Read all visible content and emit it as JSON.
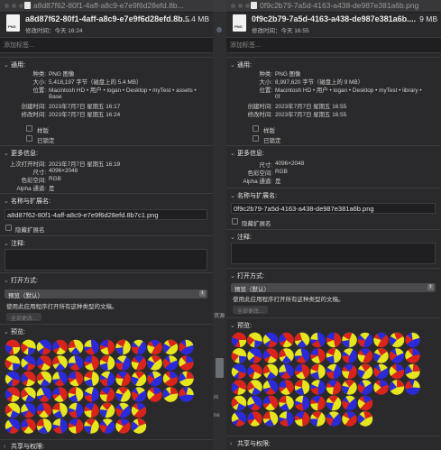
{
  "left": {
    "titlebar": "a8d87f62-80f1-4aff-a8c9-e7e9f6d28efd.8b...",
    "file_name": "a8d87f62-80f1-4aff-a8c9-e7e9f6d28efd.8b...",
    "file_size": "5.4 MB",
    "modified_short": "修改时间：今天 16:24",
    "tags_placeholder": "添加标签...",
    "general": {
      "header": "通用:",
      "kind_k": "种类:",
      "kind_v": "PNG 图像",
      "size_k": "大小:",
      "size_v": "5,418,197 字节（磁盘上的 5.4 MB）",
      "where_k": "位置:",
      "where_v": "Macintosh HD • 用户 • logan • Desktop • myTest • assets •",
      "where_v2": "Base",
      "created_k": "创建时间:",
      "created_v": "2023年7月7日 星期五 16:17",
      "modified_k": "修改时间:",
      "modified_v": "2023年7月7日 星期五 16:24",
      "stationery": "样版",
      "locked": "已锁定"
    },
    "more_info": {
      "header": "更多信息:",
      "last_opened_k": "上次打开时间:",
      "last_opened_v": "2023年7月7日 星期五 16:19",
      "dims_k": "尺寸:",
      "dims_v": "4096×2048",
      "color_k": "色彩空间:",
      "color_v": "RGB",
      "alpha_k": "Alpha 通道:",
      "alpha_v": "是"
    },
    "name_ext": {
      "header": "名称与扩展名:",
      "value": "a8d87f62-80f1-4aff-a8c9-e7e9f6d28efd.8b7c1.png",
      "hide_ext": "隐藏扩展名"
    },
    "comments": {
      "header": "注释:"
    },
    "open_with": {
      "header": "打开方式:",
      "app": "预览（默认）",
      "desc": "使用此应用程序打开所有这种类型的文稿。",
      "button": "全部更改..."
    },
    "preview": {
      "header": "预览:"
    },
    "sharing": {
      "header": "共享与权限:"
    }
  },
  "right": {
    "titlebar": "0f9c2b79-7a5d-4163-a438-de987e381a6b.png",
    "file_name": "0f9c2b79-7a5d-4163-a438-de987e381a6b....",
    "file_size": "9 MB",
    "modified_short": "修改时间：今天 16:55",
    "tags_placeholder": "添加标签...",
    "general": {
      "header": "通用:",
      "kind_k": "种类:",
      "kind_v": "PNG 图像",
      "size_k": "大小:",
      "size_v": "8,997,620 字节（磁盘上的 9 MB）",
      "where_k": "位置:",
      "where_v": "Macintosh HD • 用户 • logan • Desktop • myTest • library •",
      "where_v2": "0f",
      "created_k": "创建时间:",
      "created_v": "2023年7月7日 星期五 16:55",
      "modified_k": "修改时间:",
      "modified_v": "2023年7月7日 星期五 16:55",
      "stationery": "样版",
      "locked": "已锁定"
    },
    "more_info": {
      "header": "更多信息:",
      "dims_k": "尺寸:",
      "dims_v": "4096×2048",
      "color_k": "色彩空间:",
      "color_v": "RGB",
      "alpha_k": "Alpha 通道:",
      "alpha_v": "是"
    },
    "name_ext": {
      "header": "名称与扩展名:",
      "value": "0f9c2b79-7a5d-4163-a438-de987e381a6b.png",
      "hide_ext": "隐藏扩展名"
    },
    "comments": {
      "header": "注释:"
    },
    "open_with": {
      "header": "打开方式:",
      "app": "预览（默认）",
      "desc": "使用此应用程序打开所有这种类型的文稿。",
      "button": "全部更改..."
    },
    "preview": {
      "header": "预览:"
    },
    "sharing": {
      "header": "共享与权限:"
    }
  },
  "background": {
    "frag1": "资源",
    "frag2": "rit",
    "frag3": "ne"
  },
  "icons": {
    "section_chevron": "chevron-down-icon",
    "collapsed_chevron": "chevron-right-icon",
    "file": "png-file-icon"
  },
  "colors": {
    "panel": "#2a2a2c",
    "titlebar": "#38383a",
    "ball_red": "#d8241b",
    "ball_yellow": "#e6e61e",
    "ball_blue": "#2a2ad8"
  }
}
